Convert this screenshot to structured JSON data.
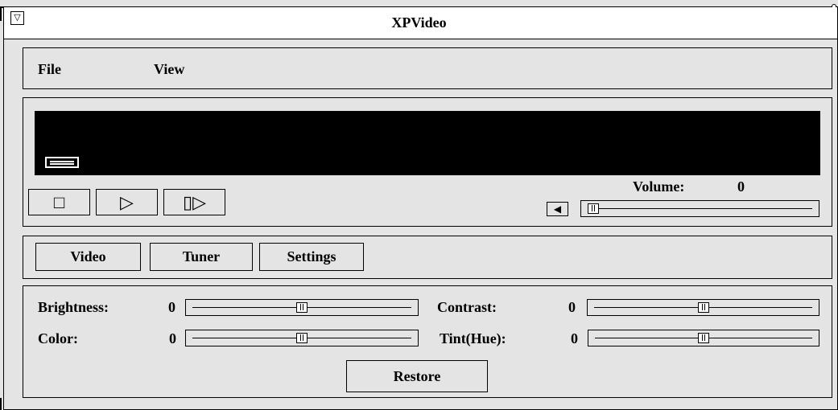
{
  "window": {
    "title": "XPVideo",
    "menu_glyph": "▽"
  },
  "menubar": {
    "items": [
      {
        "label": "File"
      },
      {
        "label": "View"
      }
    ]
  },
  "player": {
    "volume_label": "Volume:",
    "volume_value": "0",
    "volume_level": 0.0,
    "buttons": {
      "stop_glyph": "□",
      "play_glyph": "▷",
      "pause_glyph": "▯▷"
    },
    "mute_glyph": "◀"
  },
  "tabs": [
    {
      "label": "Video"
    },
    {
      "label": "Tuner"
    },
    {
      "label": "Settings"
    }
  ],
  "adjust": {
    "brightness": {
      "label": "Brightness:",
      "value": "0",
      "level": 0.5
    },
    "contrast": {
      "label": "Contrast:",
      "value": "0",
      "level": 0.5
    },
    "color": {
      "label": "Color:",
      "value": "0",
      "level": 0.5
    },
    "tint": {
      "label": "Tint(Hue):",
      "value": "0",
      "level": 0.5
    },
    "restore_label": "Restore"
  }
}
